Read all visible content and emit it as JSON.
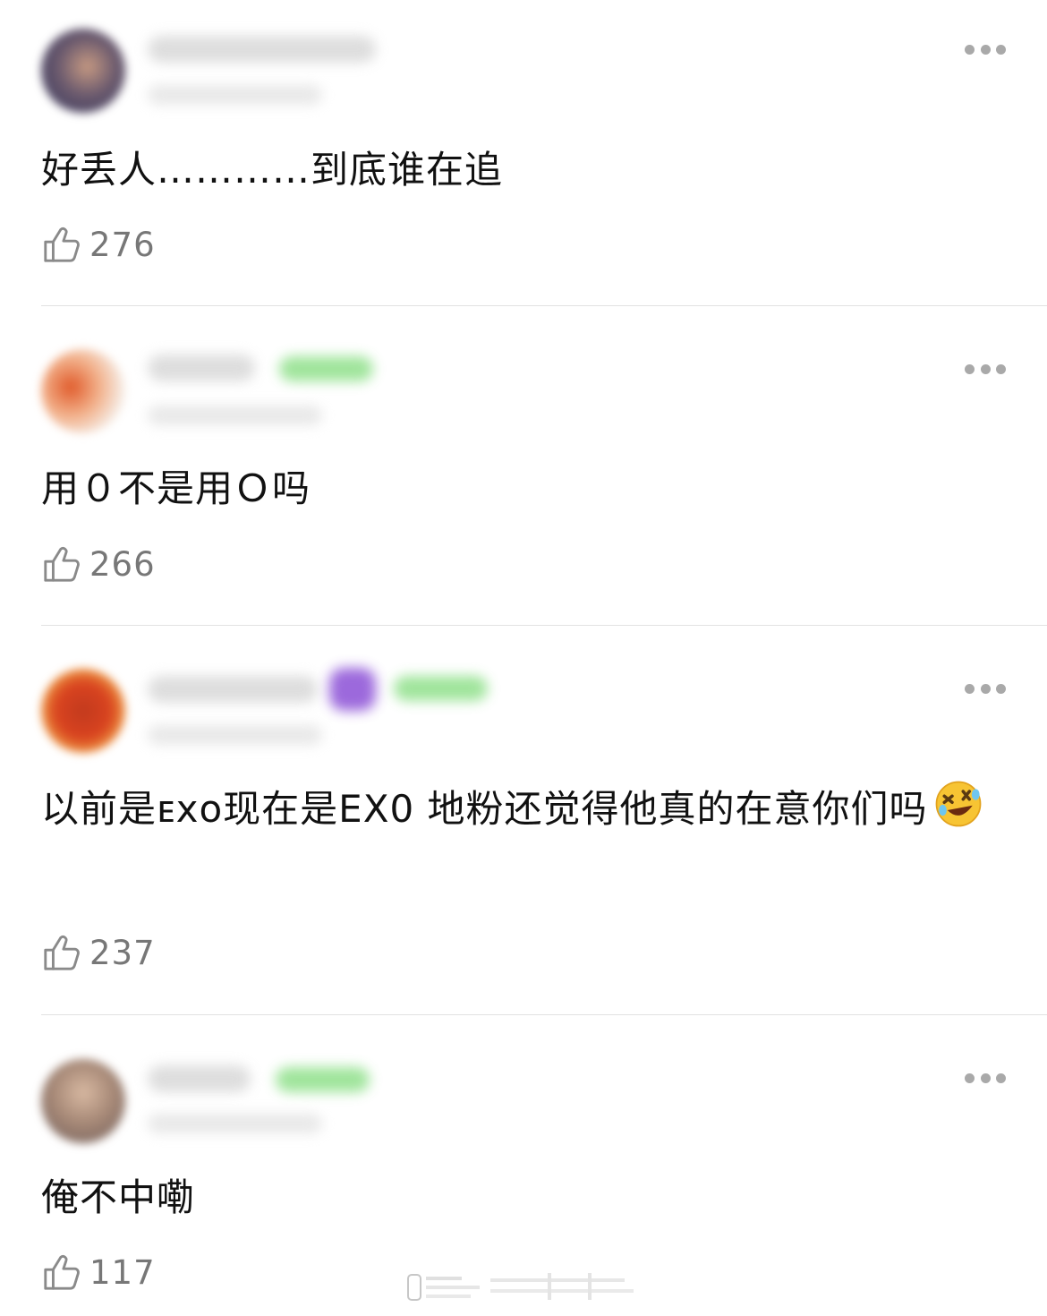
{
  "comments": [
    {
      "text": "好丢人…………到底谁在追",
      "likes": "276"
    },
    {
      "text": "用０不是用Ｏ吗",
      "likes": "266"
    },
    {
      "text": "以前是ᴇxᴏ现在是EX0 地粉还觉得他真的在意你们吗",
      "emoji": "rolling-on-floor-laughing-emoji",
      "likes": "237"
    },
    {
      "text": "俺不中嘞",
      "likes": "117"
    }
  ],
  "colors": {
    "like_icon": "#8a8a8a",
    "more_dots": "#a9a9a9",
    "badge": "#8fe08a",
    "badge_purple": "#8b4fd6"
  }
}
